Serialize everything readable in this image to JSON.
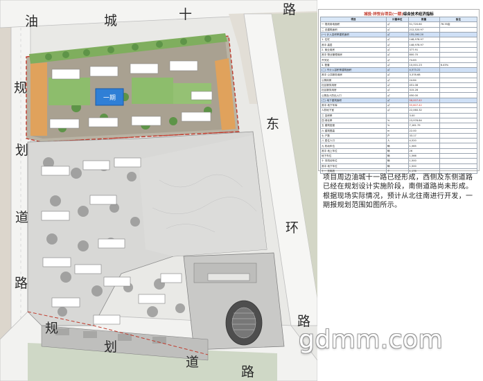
{
  "roads": {
    "north": [
      "油",
      "城",
      "十",
      "路"
    ],
    "west": [
      "规",
      "划",
      "道",
      "路"
    ],
    "east": [
      "东",
      "环",
      "路"
    ],
    "south": [
      "规",
      "划",
      "道",
      "路"
    ]
  },
  "plan_labels": {
    "phase_one": "一期"
  },
  "table": {
    "title_prefix": "城投·祥悦台项目(一期)",
    "title_suffix": "综合技术经济指标",
    "headers": [
      "项目",
      "计量单位",
      "数量",
      "备注"
    ],
    "rows": [
      {
        "name": "一 规划用地面积",
        "unit": "㎡",
        "value": "51,720.60",
        "note": "76.55亩",
        "section": false
      },
      {
        "name": "二 总建筑面积",
        "unit": "㎡",
        "value": "212,520.97",
        "note": "",
        "section": false
      },
      {
        "name": "(一) 计入容积率建筑面积",
        "unit": "㎡",
        "value": "155,090.20",
        "note": "",
        "section": true
      },
      {
        "name": "1. 住宅",
        "unit": "㎡",
        "value": "148,978.97",
        "note": "",
        "section": false
      },
      {
        "name": "其中  高层",
        "unit": "㎡",
        "value": "148,978.97",
        "note": "",
        "section": false
      },
      {
        "name": "2. 商业用房",
        "unit": "㎡",
        "value": "377.91",
        "note": "",
        "section": false
      },
      {
        "name": "其中  物业管理用房",
        "unit": "㎡",
        "value": "800.70",
        "note": "",
        "section": false
      },
      {
        "name": "      开关站",
        "unit": "㎡",
        "value": "74.83",
        "note": "",
        "section": false
      },
      {
        "name": "3. 配套",
        "unit": "㎡",
        "value": "10,001.23",
        "note": "6.45%",
        "section": false
      },
      {
        "name": "(二) 不计入容积率建筑面积",
        "unit": "㎡",
        "value": "4,573.22",
        "note": "",
        "section": true
      },
      {
        "name": "其中  公共服务用房",
        "unit": "㎡",
        "value": "3,378.68",
        "note": "",
        "section": false
      },
      {
        "name": "      公厕用房",
        "unit": "㎡",
        "value": "24.84",
        "note": "",
        "section": false
      },
      {
        "name": "      社区服务用房",
        "unit": "㎡",
        "value": "451.08",
        "note": "",
        "section": false
      },
      {
        "name": "      社区服务用房",
        "unit": "㎡",
        "value": "315.28",
        "note": "",
        "section": false
      },
      {
        "name": "      公厕及人防出入口",
        "unit": "㎡",
        "value": "450.00",
        "note": "",
        "section": false
      },
      {
        "name": "(三) 地下建筑面积",
        "unit": "㎡",
        "value": "58,007.42",
        "note": "",
        "section": true
      },
      {
        "name": "其中  地下车库",
        "unit": "㎡",
        "value": "55,807.42",
        "note": "",
        "section": false
      },
      {
        "name": "      人防地下室",
        "unit": "㎡",
        "value": "22,060.32",
        "note": "",
        "section": false
      },
      {
        "name": "三 容积率",
        "unit": "",
        "value": "3.00",
        "note": "",
        "section": false
      },
      {
        "name": "四 绿化率",
        "unit": "%",
        "value": "23,976.84",
        "note": "",
        "section": false
      },
      {
        "name": "五 建筑密度",
        "unit": "%",
        "value": "7,161.79",
        "note": "",
        "section": false
      },
      {
        "name": "六 建筑限高",
        "unit": "m",
        "value": "22.00",
        "note": "",
        "section": false
      },
      {
        "name": "七 户数",
        "unit": "户",
        "value": "33.17",
        "note": "",
        "section": false
      },
      {
        "name": "八 居住人口",
        "unit": "人",
        "value": "4,520",
        "note": "",
        "section": false
      },
      {
        "name": "九 机动车位",
        "unit": "辆",
        "value": "1,565",
        "note": "",
        "section": false
      },
      {
        "name": "其中  地上车位",
        "unit": "辆",
        "value": "26",
        "note": "",
        "section": false
      },
      {
        "name": "      地下车位",
        "unit": "辆",
        "value": "1,566",
        "note": "",
        "section": false
      },
      {
        "name": "十 非机动车位",
        "unit": "辆",
        "value": "1,500",
        "note": "",
        "section": false
      },
      {
        "name": "其中  地下车位",
        "unit": "辆",
        "value": "1,500",
        "note": "",
        "section": false
      },
      {
        "name": "十一 充电桩",
        "unit": "个",
        "value": "1,176",
        "note": "",
        "section": false
      }
    ]
  },
  "description": "项目周边油城十一路已经形成，西侧及东侧道路已经在规划设计实施阶段，南侧道路尚未形成。根据现场实际情况，预计从北往南进行开发，一期报规划范围如图所示。",
  "watermark": "gdmm.com"
}
